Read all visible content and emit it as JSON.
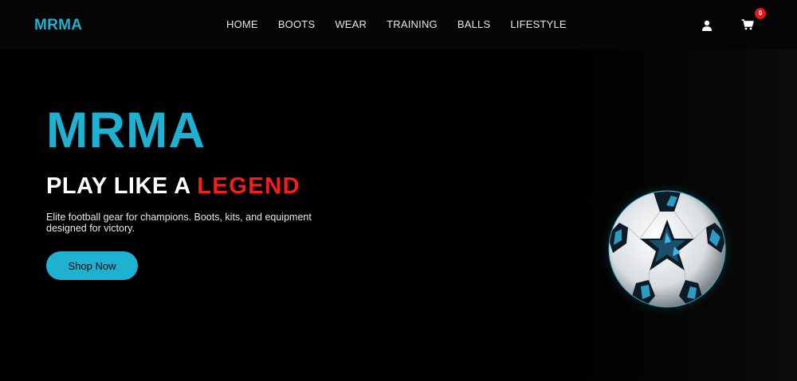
{
  "brand": {
    "name": "MRMA",
    "color": "#1eb1d1"
  },
  "nav": {
    "items": [
      {
        "label": "HOME"
      },
      {
        "label": "BOOTS"
      },
      {
        "label": "WEAR"
      },
      {
        "label": "TRAINING"
      },
      {
        "label": "BALLS"
      },
      {
        "label": "LIFESTYLE"
      }
    ],
    "user_icon": "user-icon",
    "cart_icon": "cart-icon",
    "cart_count": "0"
  },
  "hero": {
    "title": "MRMA",
    "tagline_prefix": "PLAY LIKE A",
    "tagline_accent": "LEGEND",
    "description": "Elite football gear for champions. Boots, kits, and equipment designed for victory.",
    "cta_label": "Shop Now",
    "accent_color": "#ff1a1a",
    "image_icon": "football-image"
  }
}
